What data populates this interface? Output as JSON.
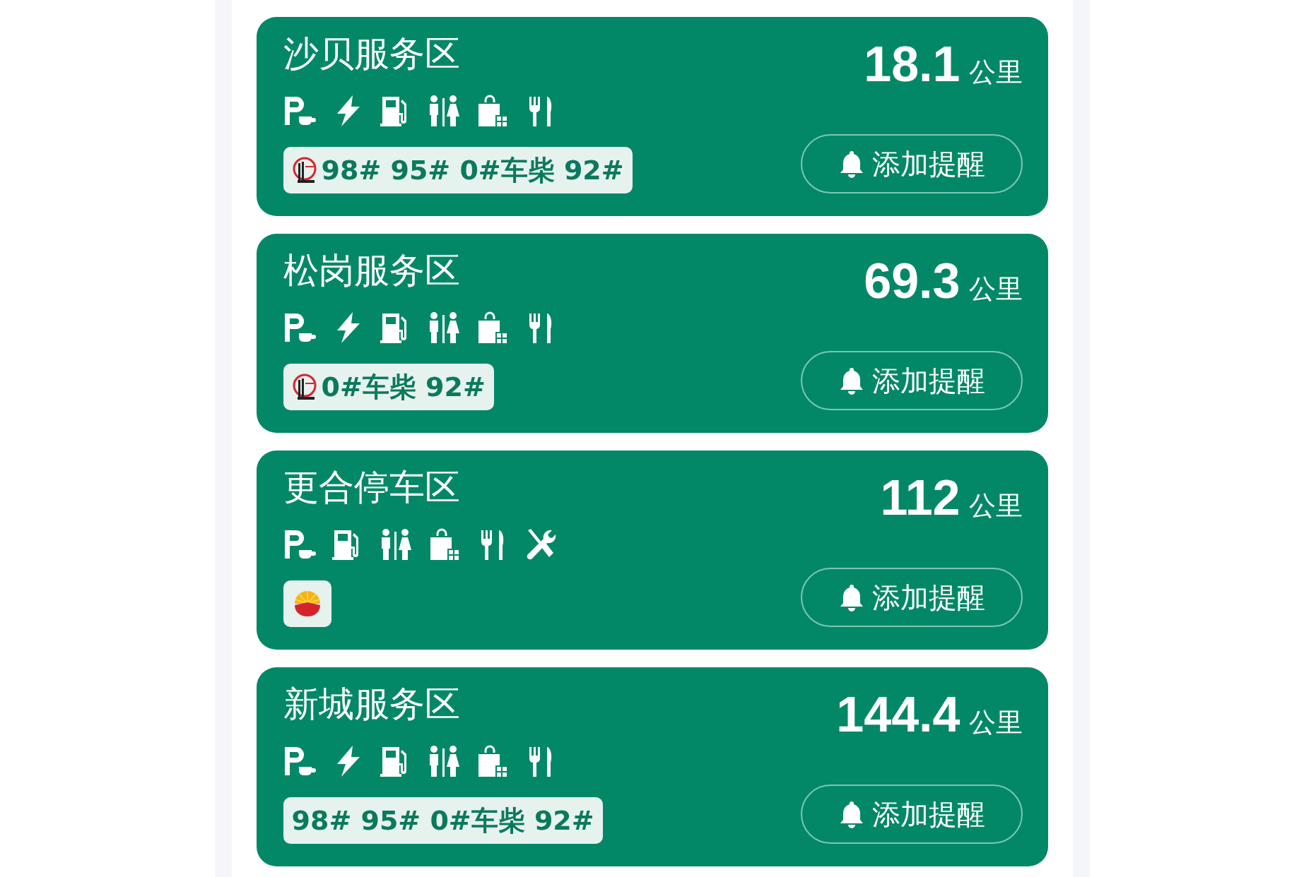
{
  "areas": [
    {
      "name": "沙贝服务区",
      "facilities": [
        {
          "kind": "parking"
        },
        {
          "kind": "charging"
        },
        {
          "kind": "fuel"
        },
        {
          "kind": "toilet"
        },
        {
          "kind": "shop"
        },
        {
          "kind": "restaurant"
        }
      ],
      "fuel": {
        "kind": "sinopec",
        "grades": "98# 95# 0#车柴 92#"
      },
      "distance": "18.1",
      "unit": "公里",
      "button": "添加提醒"
    },
    {
      "name": "松岗服务区",
      "facilities": [
        {
          "kind": "parking"
        },
        {
          "kind": "charging"
        },
        {
          "kind": "fuel"
        },
        {
          "kind": "toilet"
        },
        {
          "kind": "shop"
        },
        {
          "kind": "restaurant"
        }
      ],
      "fuel": {
        "kind": "sinopec",
        "grades": "0#车柴 92#"
      },
      "distance": "69.3",
      "unit": "公里",
      "button": "添加提醒"
    },
    {
      "name": "更合停车区",
      "facilities": [
        {
          "kind": "parking"
        },
        {
          "kind": "fuel"
        },
        {
          "kind": "toilet"
        },
        {
          "kind": "shop"
        },
        {
          "kind": "restaurant"
        },
        {
          "kind": "repair"
        }
      ],
      "fuel": {
        "kind": "petrochina"
      },
      "distance": "112",
      "unit": "公里",
      "button": "添加提醒"
    },
    {
      "name": "新城服务区",
      "facilities": [
        {
          "kind": "parking"
        },
        {
          "kind": "charging"
        },
        {
          "kind": "fuel"
        },
        {
          "kind": "toilet"
        },
        {
          "kind": "shop"
        },
        {
          "kind": "restaurant"
        }
      ],
      "fuel": {
        "grades": "98# 95# 0#车柴 92#"
      },
      "distance": "144.4",
      "unit": "公里",
      "button": "添加提醒"
    }
  ]
}
